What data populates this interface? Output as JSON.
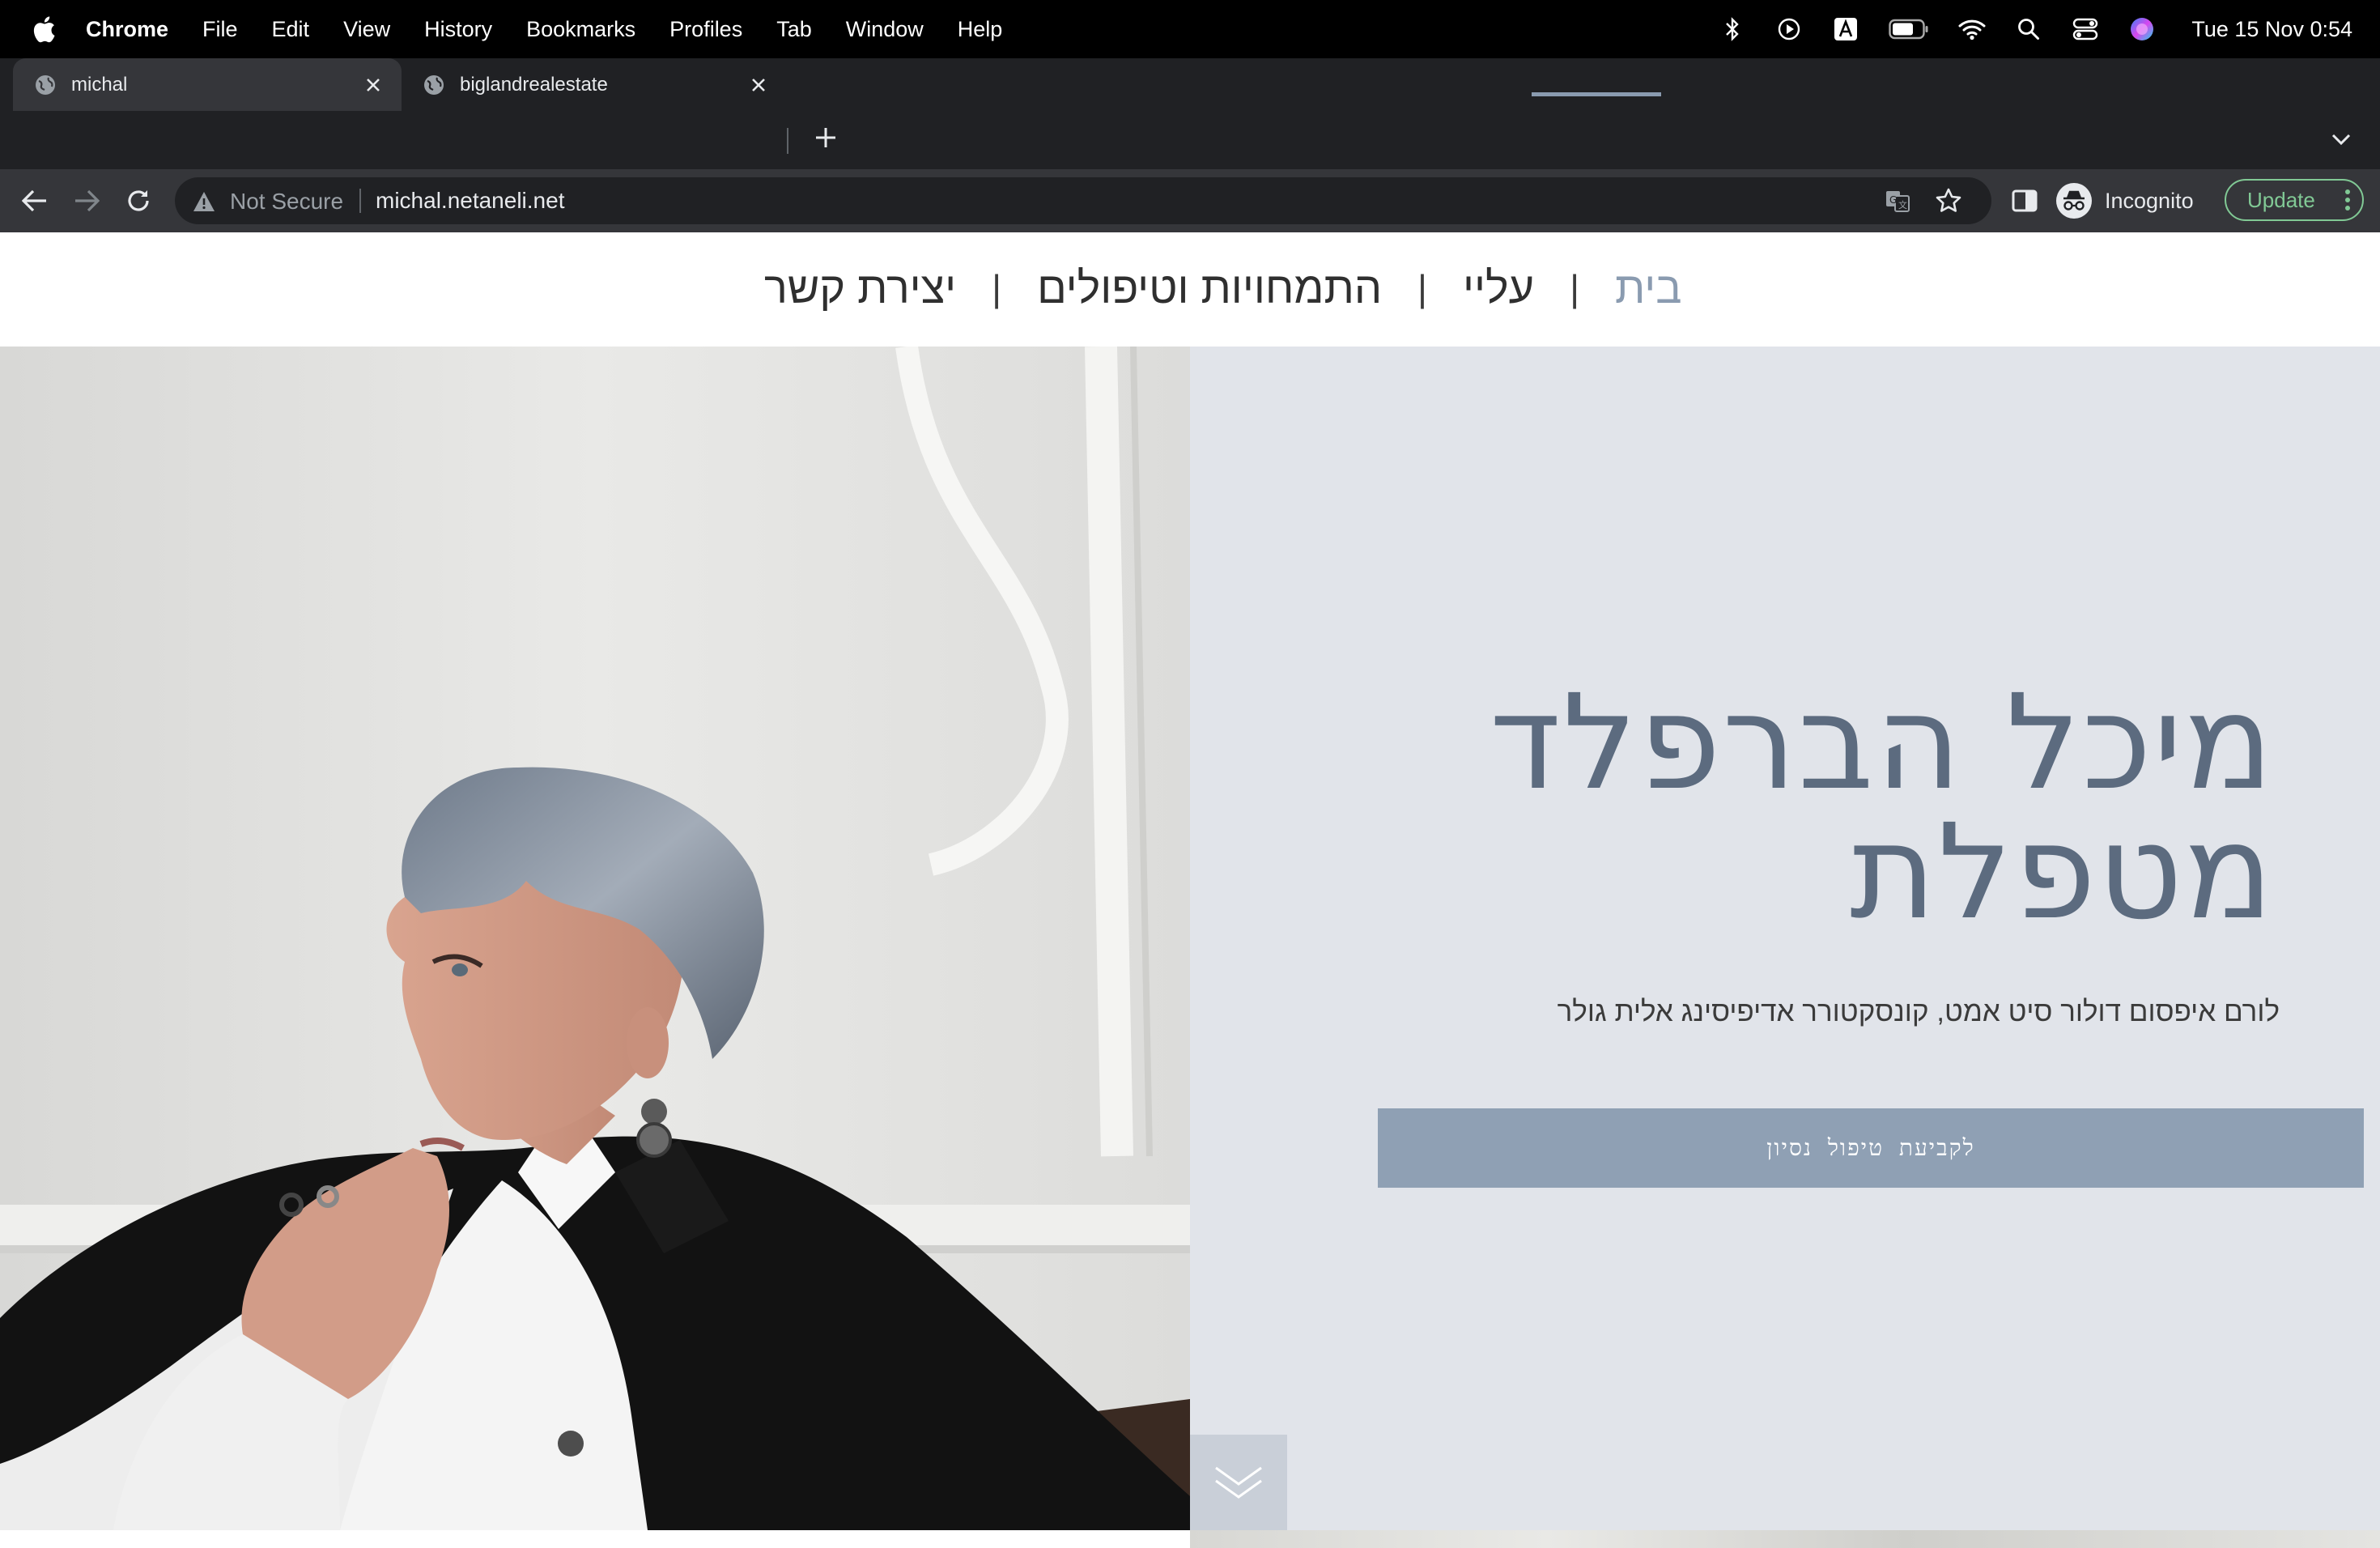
{
  "menubar": {
    "app_name": "Chrome",
    "items": [
      "File",
      "Edit",
      "View",
      "History",
      "Bookmarks",
      "Profiles",
      "Tab",
      "Window",
      "Help"
    ],
    "clock": "Tue 15 Nov  0:54",
    "status_icons": [
      "bluetooth-icon",
      "play-icon",
      "keyboard-input-icon",
      "battery-icon",
      "wifi-icon",
      "spotlight-search-icon",
      "control-center-icon",
      "siri-icon"
    ]
  },
  "tabs": [
    {
      "title": "michal",
      "active": true
    },
    {
      "title": "biglandrealestate",
      "active": false
    }
  ],
  "toolbar": {
    "security_label": "Not Secure",
    "url": "michal.netaneli.net",
    "profile_label": "Incognito",
    "update_label": "Update"
  },
  "site": {
    "nav": {
      "items": [
        "יצירת קשר",
        "התמחויות וטיפולים",
        "עליי",
        "בית"
      ],
      "separator": "|",
      "active": "בית"
    },
    "hero": {
      "title_line1": "מיכל הברפלד",
      "title_line2": "מטפלת",
      "subtitle": "לורם איפסום דולור סיט אמט, קונסקטורר אדיפיסינג אלית גולר",
      "cta_label": "לקביעת טיפול נסיון"
    },
    "colors": {
      "accent": "#8a9bb0",
      "panel_bg": "#e1e4ea",
      "title": "#5c6b7f",
      "cta_bg": "#8fa0b4"
    }
  }
}
